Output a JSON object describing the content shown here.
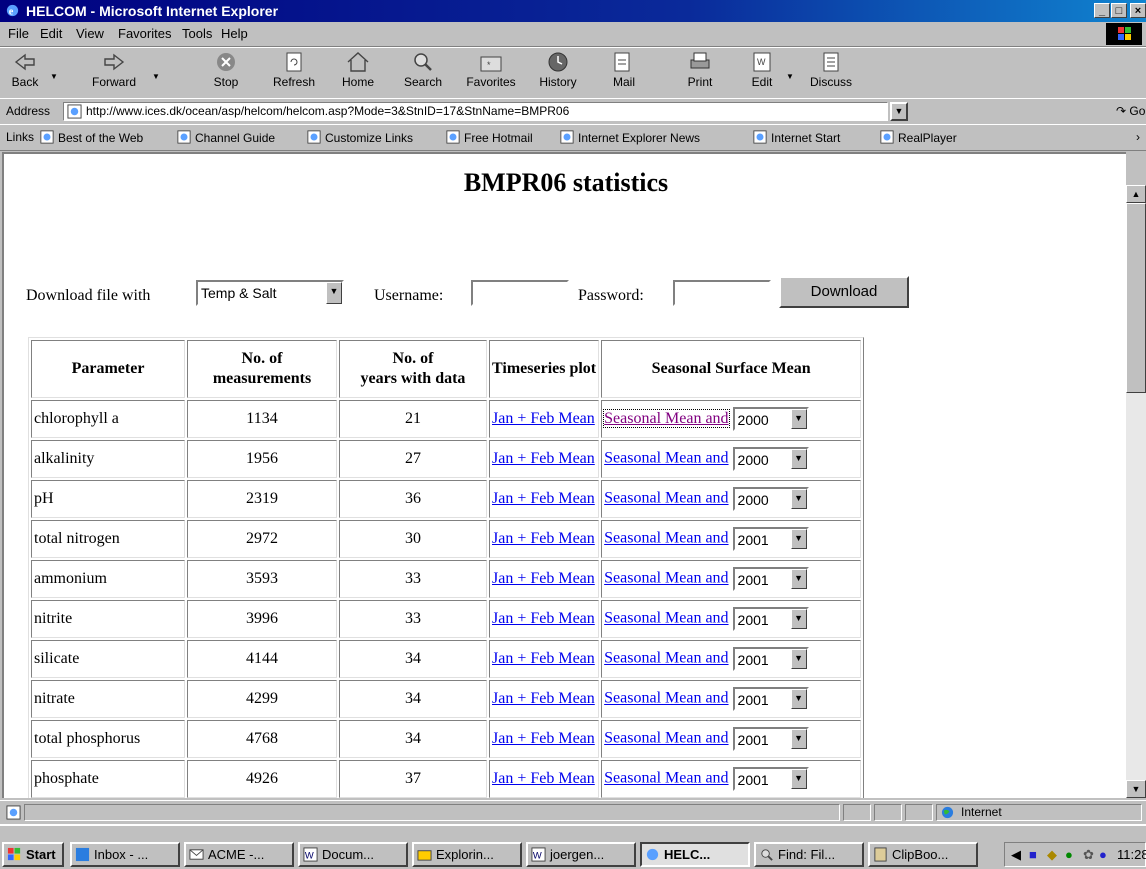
{
  "window": {
    "title": "HELCOM - Microsoft Internet Explorer",
    "min": "_",
    "max": "□",
    "close": "×"
  },
  "menu": [
    "File",
    "Edit",
    "View",
    "Favorites",
    "Tools",
    "Help"
  ],
  "toolbar": {
    "back": "Back",
    "forward": "Forward",
    "stop": "Stop",
    "refresh": "Refresh",
    "home": "Home",
    "search": "Search",
    "favorites": "Favorites",
    "history": "History",
    "mail": "Mail",
    "print": "Print",
    "edit": "Edit",
    "discuss": "Discuss"
  },
  "address": {
    "label": "Address",
    "url": "http://www.ices.dk/ocean/asp/helcom/helcom.asp?Mode=3&StnID=17&StnName=BMPR06",
    "go": "Go"
  },
  "links": {
    "label": "Links",
    "items": [
      "Best of the Web",
      "Channel Guide",
      "Customize Links",
      "Free Hotmail",
      "Internet Explorer News",
      "Internet Start",
      "RealPlayer"
    ]
  },
  "page": {
    "title": "BMPR06 statistics",
    "download_label": "Download file with",
    "download_select": "Temp & Salt",
    "username_label": "Username:",
    "password_label": "Password:",
    "download_button": "Download",
    "headers": {
      "parameter": "Parameter",
      "measurements_1": "No. of",
      "measurements_2": "measurements",
      "years_1": "No. of",
      "years_2": "years with data",
      "timeseries": "Timeseries plot",
      "seasonal": "Seasonal Surface Mean"
    },
    "rows": [
      {
        "parameter": "chlorophyll a",
        "measurements": "1134",
        "years": "21",
        "ts_link": "Jan + Feb Mean",
        "sm_link": "Seasonal Mean and",
        "year": "2000"
      },
      {
        "parameter": "alkalinity",
        "measurements": "1956",
        "years": "27",
        "ts_link": "Jan + Feb Mean",
        "sm_link": "Seasonal Mean and",
        "year": "2000"
      },
      {
        "parameter": "pH",
        "measurements": "2319",
        "years": "36",
        "ts_link": "Jan + Feb Mean",
        "sm_link": "Seasonal Mean and",
        "year": "2000"
      },
      {
        "parameter": "total nitrogen",
        "measurements": "2972",
        "years": "30",
        "ts_link": "Jan + Feb Mean",
        "sm_link": "Seasonal Mean and",
        "year": "2001"
      },
      {
        "parameter": "ammonium",
        "measurements": "3593",
        "years": "33",
        "ts_link": "Jan + Feb Mean",
        "sm_link": "Seasonal Mean and",
        "year": "2001"
      },
      {
        "parameter": "nitrite",
        "measurements": "3996",
        "years": "33",
        "ts_link": "Jan + Feb Mean",
        "sm_link": "Seasonal Mean and",
        "year": "2001"
      },
      {
        "parameter": "silicate",
        "measurements": "4144",
        "years": "34",
        "ts_link": "Jan + Feb Mean",
        "sm_link": "Seasonal Mean and",
        "year": "2001"
      },
      {
        "parameter": "nitrate",
        "measurements": "4299",
        "years": "34",
        "ts_link": "Jan + Feb Mean",
        "sm_link": "Seasonal Mean and",
        "year": "2001"
      },
      {
        "parameter": "total phosphorus",
        "measurements": "4768",
        "years": "34",
        "ts_link": "Jan + Feb Mean",
        "sm_link": "Seasonal Mean and",
        "year": "2001"
      },
      {
        "parameter": "phosphate",
        "measurements": "4926",
        "years": "37",
        "ts_link": "Jan + Feb Mean",
        "sm_link": "Seasonal Mean and",
        "year": "2001"
      }
    ]
  },
  "status": {
    "zone": "Internet"
  },
  "taskbar": {
    "start": "Start",
    "tasks": [
      "Inbox - ...",
      "ACME -...",
      "Docum...",
      "Explorin...",
      "joergen...",
      "HELC...",
      "Find: Fil...",
      "ClipBoo..."
    ],
    "clock": "11:28"
  },
  "colors": {
    "link": "#0000ee",
    "visited": "#800080",
    "titlebar": "#000080"
  }
}
